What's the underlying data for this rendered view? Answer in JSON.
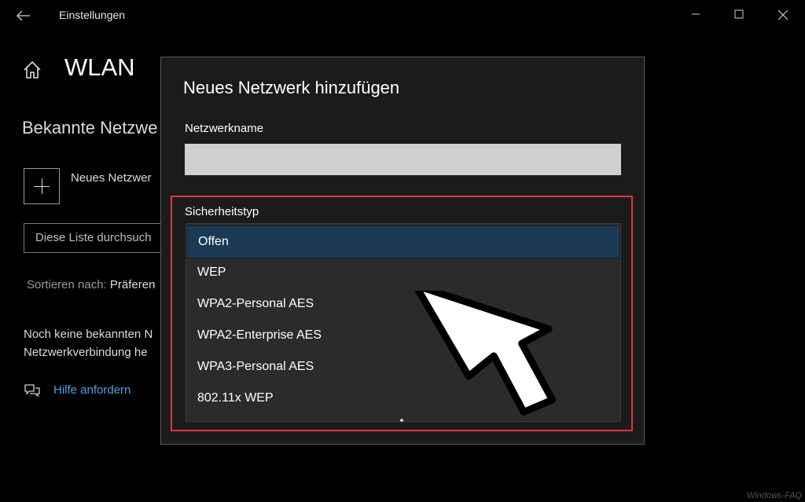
{
  "window": {
    "title": "Einstellungen",
    "back_icon": "back-arrow-icon",
    "minimize_icon": "minimize-icon",
    "maximize_icon": "maximize-icon",
    "close_icon": "close-icon"
  },
  "page": {
    "title": "WLAN",
    "home_icon": "home-icon",
    "section_title": "Bekannte Netzwe",
    "add_network_label": "Neues Netzwer",
    "search_placeholder": "Diese Liste durchsuch",
    "sort_label": "Sortieren nach: ",
    "sort_value": "Präferen",
    "no_networks_line1": "Noch keine bekannten N",
    "no_networks_line2": "Netzwerkverbindung he",
    "help_icon": "help-chat-icon",
    "help_link": "Hilfe anfordern"
  },
  "dialog": {
    "title": "Neues Netzwerk hinzufügen",
    "network_name_label": "Netzwerkname",
    "network_name_value": "",
    "security_type_label": "Sicherheitstyp",
    "security_options": [
      "Offen",
      "WEP",
      "WPA2-Personal AES",
      "WPA2-Enterprise AES",
      "WPA3-Personal AES",
      "802.11x WEP"
    ],
    "selected_option": "Offen"
  },
  "annotation": {
    "highlight_color": "#e0353a",
    "arrow_icon": "pointer-arrow-icon"
  },
  "watermark": "Windows-FAQ"
}
